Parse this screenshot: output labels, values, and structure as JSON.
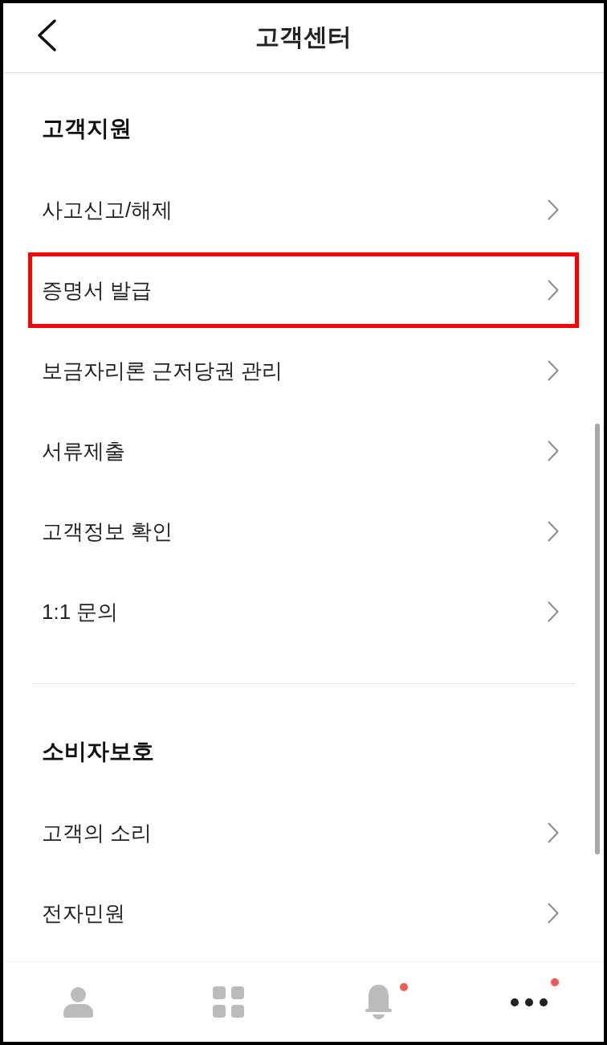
{
  "header": {
    "title": "고객센터"
  },
  "sections": [
    {
      "title": "고객지원",
      "items": [
        {
          "label": "사고신고/해제",
          "highlighted": false
        },
        {
          "label": "증명서 발급",
          "highlighted": true
        },
        {
          "label": "보금자리론 근저당권 관리",
          "highlighted": false
        },
        {
          "label": "서류제출",
          "highlighted": false
        },
        {
          "label": "고객정보 확인",
          "highlighted": false
        },
        {
          "label": "1:1 문의",
          "highlighted": false
        }
      ]
    },
    {
      "title": "소비자보호",
      "items": [
        {
          "label": "고객의 소리",
          "highlighted": false
        },
        {
          "label": "전자민원",
          "highlighted": false
        }
      ]
    }
  ],
  "bottom_nav": [
    {
      "kind": "person",
      "selected": false,
      "badge": false
    },
    {
      "kind": "grid",
      "selected": false,
      "badge": false
    },
    {
      "kind": "bell",
      "selected": false,
      "badge": true
    },
    {
      "kind": "more",
      "selected": true,
      "badge": true
    }
  ]
}
